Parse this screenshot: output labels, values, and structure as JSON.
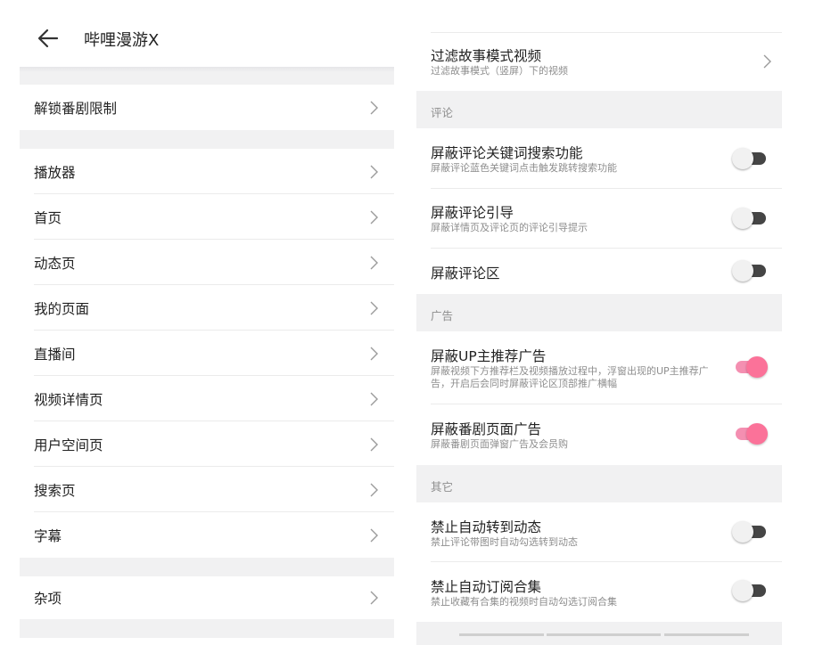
{
  "left": {
    "title": "哔哩漫游X",
    "groups": [
      {
        "items": [
          {
            "label": "解锁番剧限制"
          }
        ]
      },
      {
        "items": [
          {
            "label": "播放器"
          },
          {
            "label": "首页"
          },
          {
            "label": "动态页"
          },
          {
            "label": "我的页面"
          },
          {
            "label": "直播间"
          },
          {
            "label": "视频详情页"
          },
          {
            "label": "用户空间页"
          },
          {
            "label": "搜索页"
          },
          {
            "label": "字幕"
          }
        ]
      },
      {
        "items": [
          {
            "label": "杂项"
          }
        ]
      }
    ]
  },
  "right": {
    "story_filter": {
      "title": "过滤故事模式视频",
      "subtitle": "过滤故事模式（竖屏）下的视频"
    },
    "sections": [
      {
        "header": "评论",
        "items": [
          {
            "title": "屏蔽评论关键词搜索功能",
            "subtitle": "屏蔽评论蓝色关键词点击触发跳转搜索功能",
            "on": false
          },
          {
            "title": "屏蔽评论引导",
            "subtitle": "屏蔽详情页及评论页的评论引导提示",
            "on": false
          },
          {
            "title": "屏蔽评论区",
            "subtitle": "",
            "on": false
          }
        ]
      },
      {
        "header": "广告",
        "items": [
          {
            "title": "屏蔽UP主推荐广告",
            "subtitle": "屏蔽视频下方推荐栏及视频播放过程中，浮窗出现的UP主推荐广告，开启后会同时屏蔽评论区顶部推广横幅",
            "on": true
          },
          {
            "title": "屏蔽番剧页面广告",
            "subtitle": "屏蔽番剧页面弹窗广告及会员购",
            "on": true
          }
        ]
      },
      {
        "header": "其它",
        "items": [
          {
            "title": "禁止自动转到动态",
            "subtitle": "禁止评论带图时自动勾选转到动态",
            "on": false
          },
          {
            "title": "禁止自动订阅合集",
            "subtitle": "禁止收藏有合集的视频时自动勾选订阅合集",
            "on": false
          }
        ]
      }
    ]
  },
  "icons": {
    "back": "arrow-left-icon",
    "chevron": "chevron-right-icon"
  },
  "colors": {
    "accent": "#fb7299",
    "section_bg": "#f1f1f2",
    "subtitle": "#8e8e8e",
    "toggle_off": "#454545"
  }
}
